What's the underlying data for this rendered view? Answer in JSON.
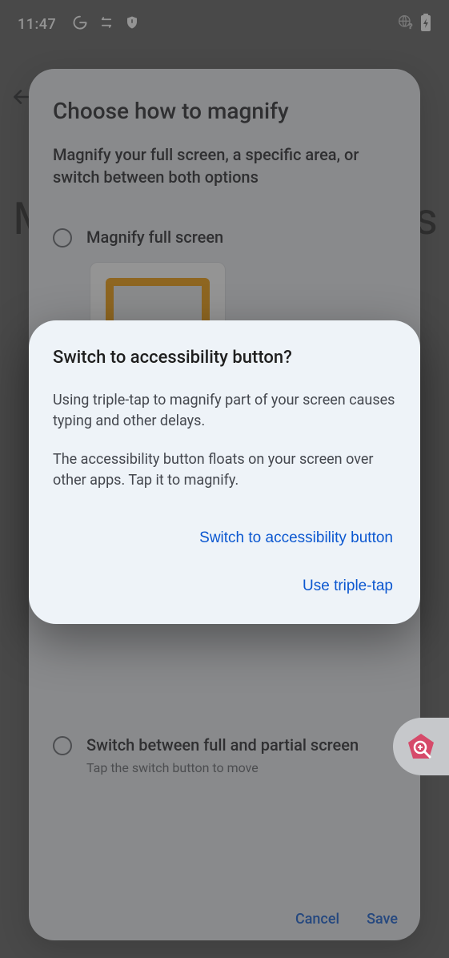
{
  "statusbar": {
    "time": "11:47"
  },
  "bg": {
    "letterLeft": "M",
    "letterRight": "s"
  },
  "settingsSheet": {
    "title": "Choose how to magnify",
    "subtitle": "Magnify your full screen, a specific area, or switch between both options",
    "option1": {
      "label": "Magnify full screen"
    },
    "option2": {
      "label": "Switch between full and partial screen",
      "hint": "Tap the switch button to move"
    },
    "cancel": "Cancel",
    "save": "Save"
  },
  "dialog": {
    "title": "Switch to accessibility button?",
    "para1": "Using triple-tap to magnify part of your screen causes typing and other delays.",
    "para2": "The accessibility button floats on your screen over other apps. Tap it to magnify.",
    "primary": "Switch to accessibility button",
    "secondary": "Use triple-tap"
  }
}
